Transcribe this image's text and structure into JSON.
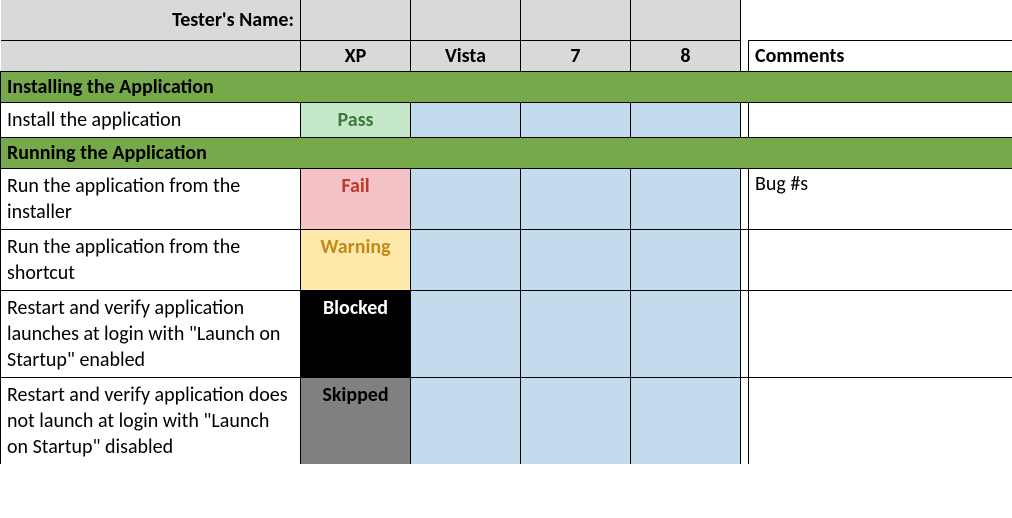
{
  "header": {
    "tester_label": "Tester's Name:",
    "os_columns": [
      "XP",
      "Vista",
      "7",
      "8"
    ],
    "comments_label": "Comments"
  },
  "sections": [
    {
      "title": "Installing the Application",
      "rows": [
        {
          "label": "Install the application",
          "xp": {
            "text": "Pass",
            "status": "pass"
          },
          "vista": {
            "text": "",
            "status": ""
          },
          "seven": {
            "text": "",
            "status": ""
          },
          "eight": {
            "text": "",
            "status": ""
          },
          "comment": ""
        }
      ]
    },
    {
      "title": "Running the Application",
      "rows": [
        {
          "label": "Run the application from the installer",
          "xp": {
            "text": "Fail",
            "status": "fail"
          },
          "vista": {
            "text": "",
            "status": ""
          },
          "seven": {
            "text": "",
            "status": ""
          },
          "eight": {
            "text": "",
            "status": ""
          },
          "comment": "Bug #s"
        },
        {
          "label": "Run the application from the shortcut",
          "xp": {
            "text": "Warning",
            "status": "warning"
          },
          "vista": {
            "text": "",
            "status": ""
          },
          "seven": {
            "text": "",
            "status": ""
          },
          "eight": {
            "text": "",
            "status": ""
          },
          "comment": ""
        },
        {
          "label": "Restart and verify application launches at login with \"Launch on Startup\" enabled",
          "xp": {
            "text": "Blocked",
            "status": "blocked"
          },
          "vista": {
            "text": "",
            "status": ""
          },
          "seven": {
            "text": "",
            "status": ""
          },
          "eight": {
            "text": "",
            "status": ""
          },
          "comment": ""
        },
        {
          "label": "Restart and verify application does not launch at login with \"Launch on Startup\" disabled",
          "xp": {
            "text": "Skipped",
            "status": "skipped"
          },
          "vista": {
            "text": "",
            "status": ""
          },
          "seven": {
            "text": "",
            "status": ""
          },
          "eight": {
            "text": "",
            "status": ""
          },
          "comment": ""
        }
      ]
    }
  ]
}
